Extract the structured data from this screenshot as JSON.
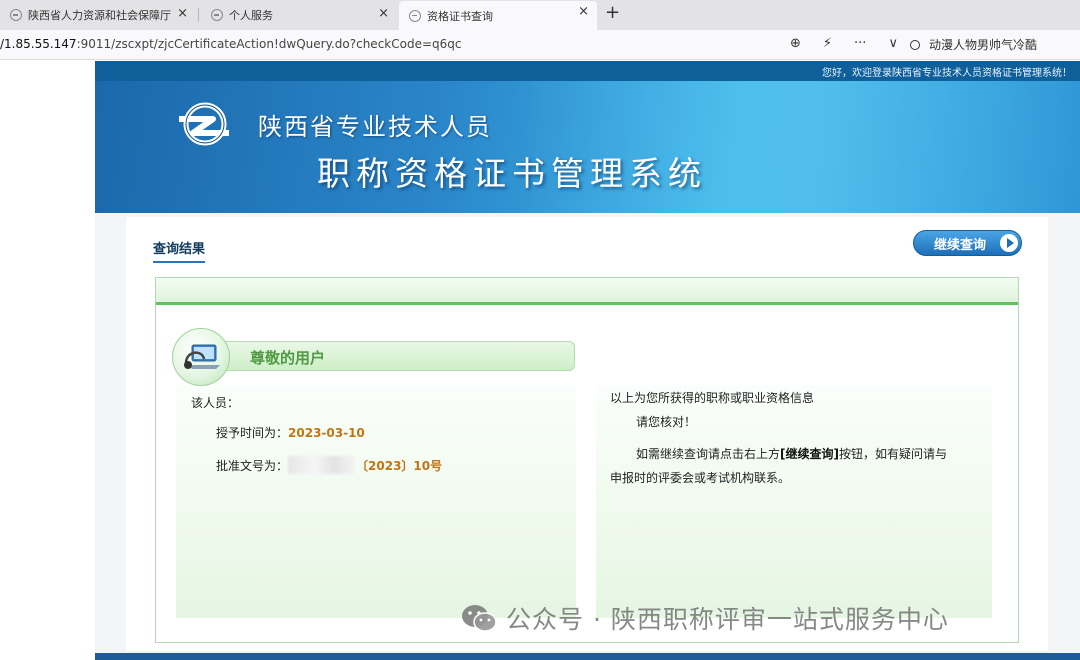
{
  "browser": {
    "tabs": [
      {
        "title": "陕西省人力资源和社会保障厅",
        "close": "×"
      },
      {
        "title": "个人服务",
        "close": "×"
      },
      {
        "title": "资格证书查询",
        "close": "×"
      }
    ],
    "new_tab": "+",
    "url_prefix": "/1.85.55.147",
    "url_rest": ":9011/zscxpt/zjcCertificateAction!dwQuery.do?checkCode=q6qc",
    "toolbar": {
      "zoom": "⊕",
      "bolt": "⚡",
      "more": "···",
      "dropdown": "∨"
    },
    "search_text": "动漫人物男帅气冷酷"
  },
  "header": {
    "welcome": "您好，欢迎登录陕西省专业技术人员资格证书管理系统！",
    "title_line1": "陕西省专业技术人员",
    "title_line2": "职称资格证书管理系统"
  },
  "main": {
    "result_title": "查询结果",
    "continue_label": "继续查询",
    "user_heading": "尊敬的用户",
    "left": {
      "person_label": "该人员：",
      "grant_label": "授予时间为：",
      "grant_value": "2023-03-10",
      "doc_label": "批准文号为：",
      "doc_value": "〔2023〕10号"
    },
    "right": {
      "line1": "以上为您所获得的职称或职业资格信息",
      "line2": "请您核对！",
      "line3_pre": "如需继续查询请点击右上方",
      "line3_bold": "[继续查询]",
      "line3_post": "按钮，如有疑问请与",
      "line4": "申报时的评委会或考试机构联系。"
    }
  },
  "watermark": "公众号 · 陕西职称评审一站式服务中心"
}
